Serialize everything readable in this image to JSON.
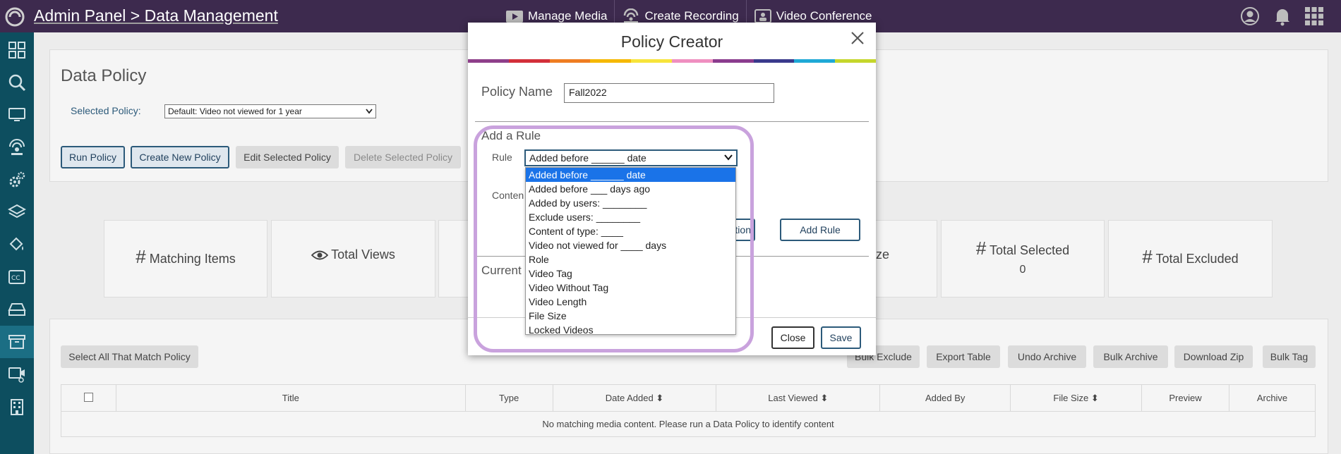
{
  "app": {
    "breadcrumb": "Admin Panel > Data Management"
  },
  "topnav": {
    "manage_media": "Manage Media",
    "create_recording": "Create Recording",
    "video_conference": "Video Conference"
  },
  "data_policy": {
    "title": "Data Policy",
    "selected_policy_label": "Selected Policy:",
    "selected_policy_value": "Default: Video not viewed for 1 year",
    "run_policy": "Run Policy",
    "create_new_policy": "Create New Policy",
    "edit_selected_policy": "Edit Selected Policy",
    "delete_selected_policy": "Delete Selected Policy"
  },
  "stats": {
    "matching_items": "Matching Items",
    "total_views": "Total Views",
    "size_partial": "ize",
    "total_selected": "Total Selected",
    "total_selected_value": "0",
    "total_excluded": "Total Excluded"
  },
  "actions": {
    "select_all": "Select All That Match Policy",
    "bulk_exclude": "Bulk Exclude",
    "export_table": "Export Table",
    "undo_archive": "Undo Archive",
    "bulk_archive": "Bulk Archive",
    "download_zip": "Download Zip",
    "bulk_tag": "Bulk Tag"
  },
  "table": {
    "columns": [
      "Title",
      "Type",
      "Date Added",
      "Last Viewed",
      "Added By",
      "File Size",
      "Preview",
      "Archive"
    ],
    "empty_message": "No matching media content. Please run a Data Policy to identify content"
  },
  "modal": {
    "title": "Policy Creator",
    "policy_name_label": "Policy Name",
    "policy_name_value": "Fall2022",
    "add_rule_heading": "Add a Rule",
    "rule_label": "Rule",
    "content_label_partial": "Conten",
    "action_partial": "ction",
    "add_rule_button": "Add Rule",
    "current_partial": "Current",
    "close_button": "Close",
    "save_button": "Save",
    "rule_selected": "Added before ______ date",
    "rule_options": [
      "Added before ______ date",
      "Added before ___ days ago",
      "Added by users: ________",
      "Exclude users: ________",
      "Content of type: ____",
      "Video not viewed for ____ days",
      "Role",
      "Video Tag",
      "Video Without Tag",
      "Video Length",
      "File Size",
      "Locked Videos"
    ]
  },
  "colors": {
    "topbar": "#3d2a4e",
    "sidebar": "#0d4e5f",
    "accent": "#2c5a7a",
    "highlight": "#c9a2dd",
    "dropdown_selected": "#1a73e8",
    "rainbow": [
      "#8e3f8a",
      "#d32f3a",
      "#ef7d22",
      "#f5b800",
      "#f7e43b",
      "#ef8fc0",
      "#8a3c8e",
      "#3a3a8c",
      "#1fa9d6",
      "#c5d62b"
    ]
  },
  "icons": {
    "topbar_right": [
      "user-icon",
      "bell-icon",
      "apps-grid-icon"
    ],
    "sidebar": [
      "dashboard-icon",
      "search-icon",
      "monitor-icon",
      "broadcast-icon",
      "settings-icon",
      "layers-icon",
      "paint-bucket-icon",
      "closed-caption-icon",
      "drive-icon",
      "archive-icon",
      "video-camera-icon",
      "building-icon"
    ]
  }
}
